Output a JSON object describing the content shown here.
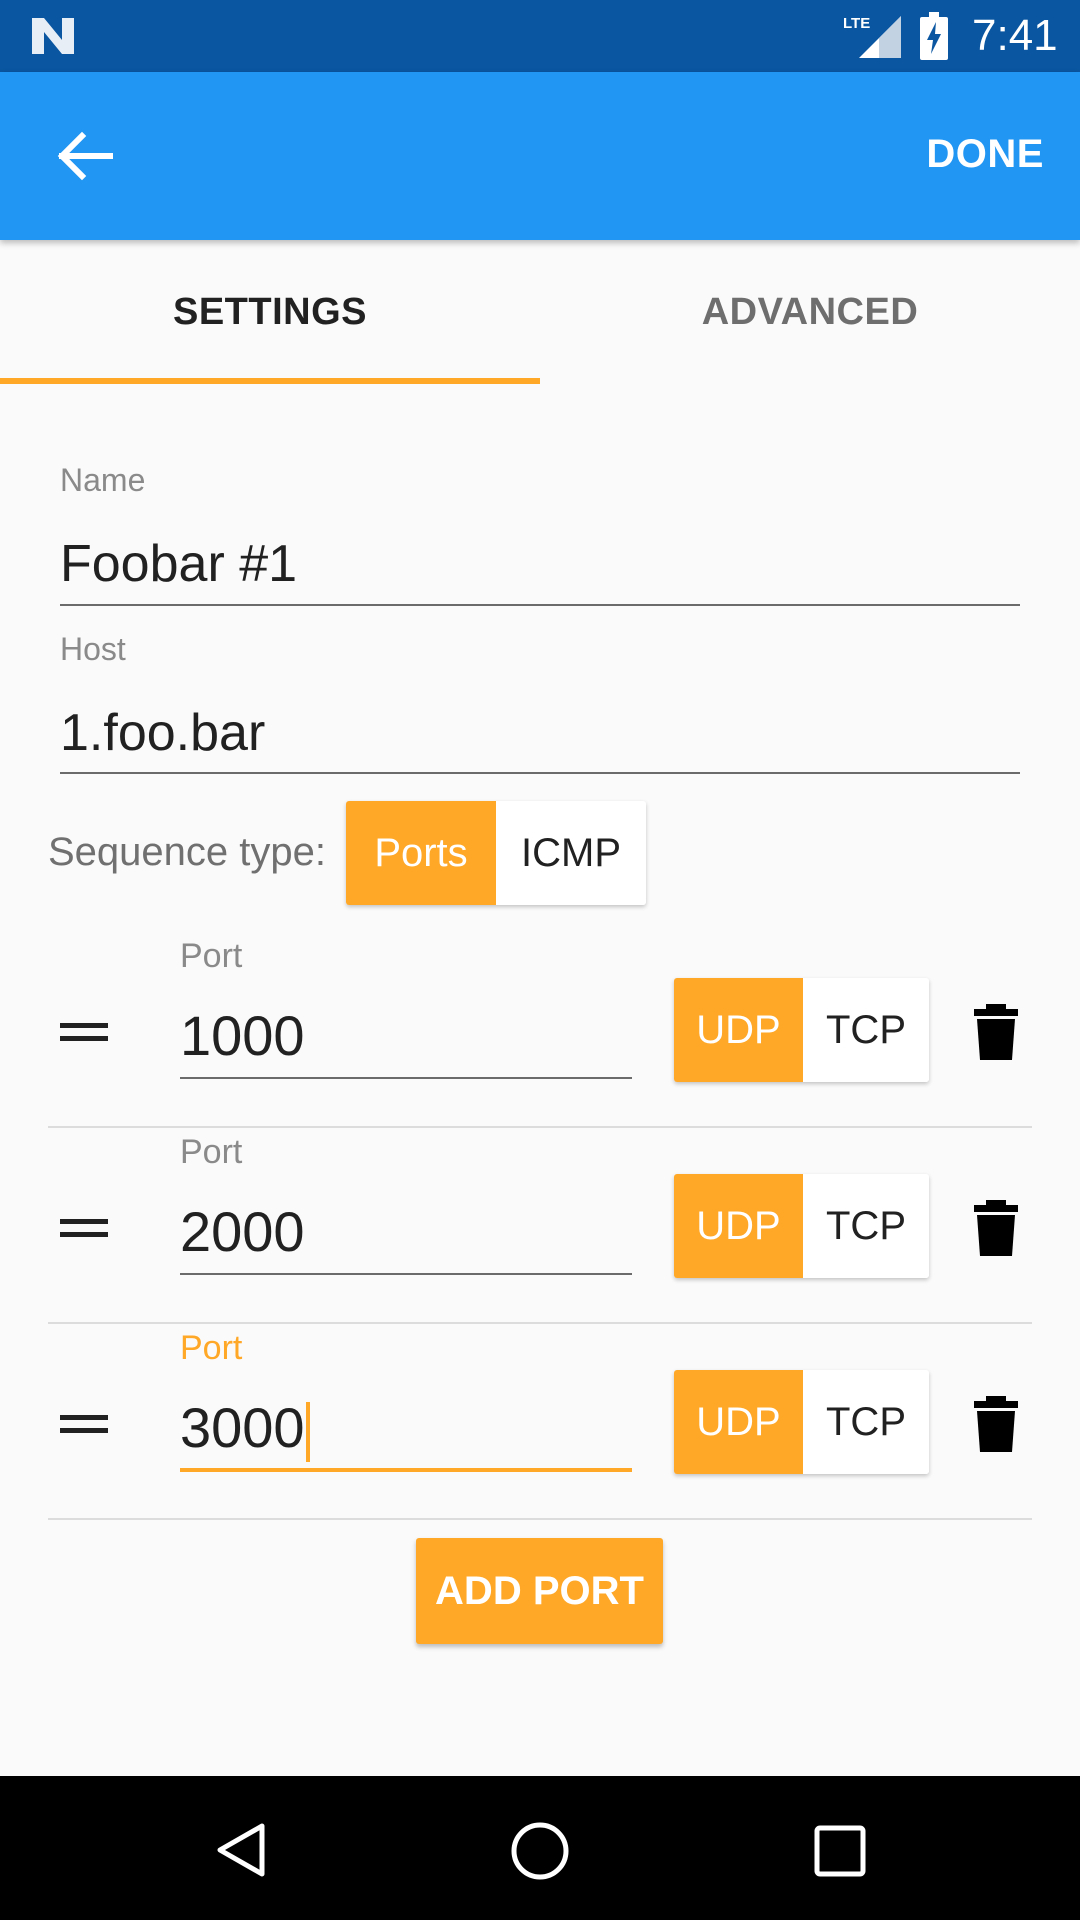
{
  "status_bar": {
    "time": "7:41",
    "network_label": "LTE",
    "icons": [
      "n-logo-icon",
      "lte-signal-icon",
      "battery-charging-icon"
    ]
  },
  "app_bar": {
    "back_icon": "arrow-back-icon",
    "done_label": "DONE"
  },
  "tabs": [
    {
      "label": "SETTINGS",
      "active": true
    },
    {
      "label": "ADVANCED",
      "active": false
    }
  ],
  "form": {
    "name": {
      "label": "Name",
      "value": "Foobar #1"
    },
    "host": {
      "label": "Host",
      "value": "1.foo.bar"
    },
    "sequence_type": {
      "label": "Sequence type:",
      "options": [
        "Ports",
        "ICMP"
      ],
      "selected": "Ports"
    }
  },
  "ports": [
    {
      "label": "Port",
      "value": "1000",
      "protocols": [
        "UDP",
        "TCP"
      ],
      "selected": "UDP",
      "focused": false
    },
    {
      "label": "Port",
      "value": "2000",
      "protocols": [
        "UDP",
        "TCP"
      ],
      "selected": "UDP",
      "focused": false
    },
    {
      "label": "Port",
      "value": "3000",
      "protocols": [
        "UDP",
        "TCP"
      ],
      "selected": "UDP",
      "focused": true
    }
  ],
  "add_port_label": "ADD PORT",
  "colors": {
    "status_bar": "#0a56a0",
    "app_bar": "#2196f3",
    "accent": "#ffa726",
    "background": "#fafafa"
  },
  "nav_bar": {
    "icons": [
      "back-triangle-icon",
      "home-circle-icon",
      "recents-square-icon"
    ]
  }
}
